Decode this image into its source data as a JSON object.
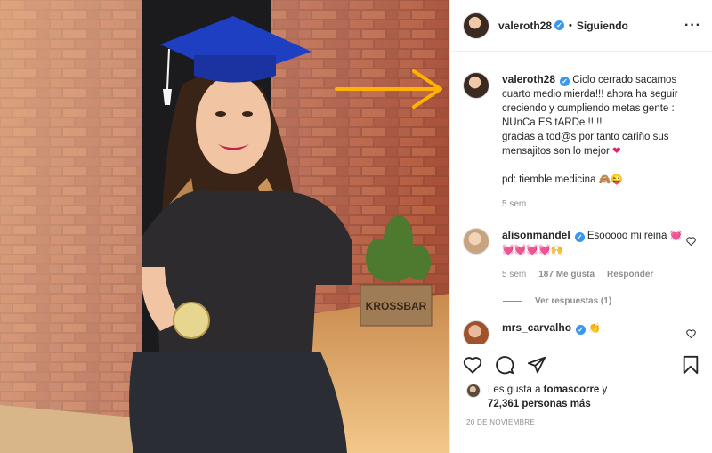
{
  "photo": {
    "sign_text": "KROSSBAR"
  },
  "post": {
    "username": "valeroth28",
    "follow_sep": "•",
    "follow_label": "Siguiendo",
    "more_label": "···"
  },
  "caption": {
    "username": "valeroth28",
    "line1": "Ciclo cerrado sacamos cuarto medio mierda!!! ahora ha seguir creciendo y cumpliendo metas gente : NUnCa ES tARDe !!!!!",
    "line2": "gracias a tod@s por tanto cariño sus mensajitos son lo mejor",
    "line2_emoji": "❤",
    "line3": "pd: tiemble medicina",
    "line3_emoji": "🙈😜",
    "time": "5 sem"
  },
  "comments": [
    {
      "username": "alisonmandel",
      "text": "Esooooo mi reina",
      "emoji": "💓💓💓💓💓🙌",
      "time": "5 sem",
      "likes": "187 Me gusta",
      "reply_label": "Responder",
      "view_replies": "Ver respuestas (1)"
    },
    {
      "username": "mrs_carvalho",
      "emoji": "👏"
    }
  ],
  "likes_line": {
    "prefix": "Les gusta a",
    "user": "tomascorre",
    "mid": "y",
    "count": "72,361 personas más"
  },
  "date": "20 DE NOVIEMBRE",
  "icons": [
    "heart-icon",
    "comment-icon",
    "share-icon",
    "bookmark-icon",
    "verified-badge-icon",
    "more-icon"
  ]
}
